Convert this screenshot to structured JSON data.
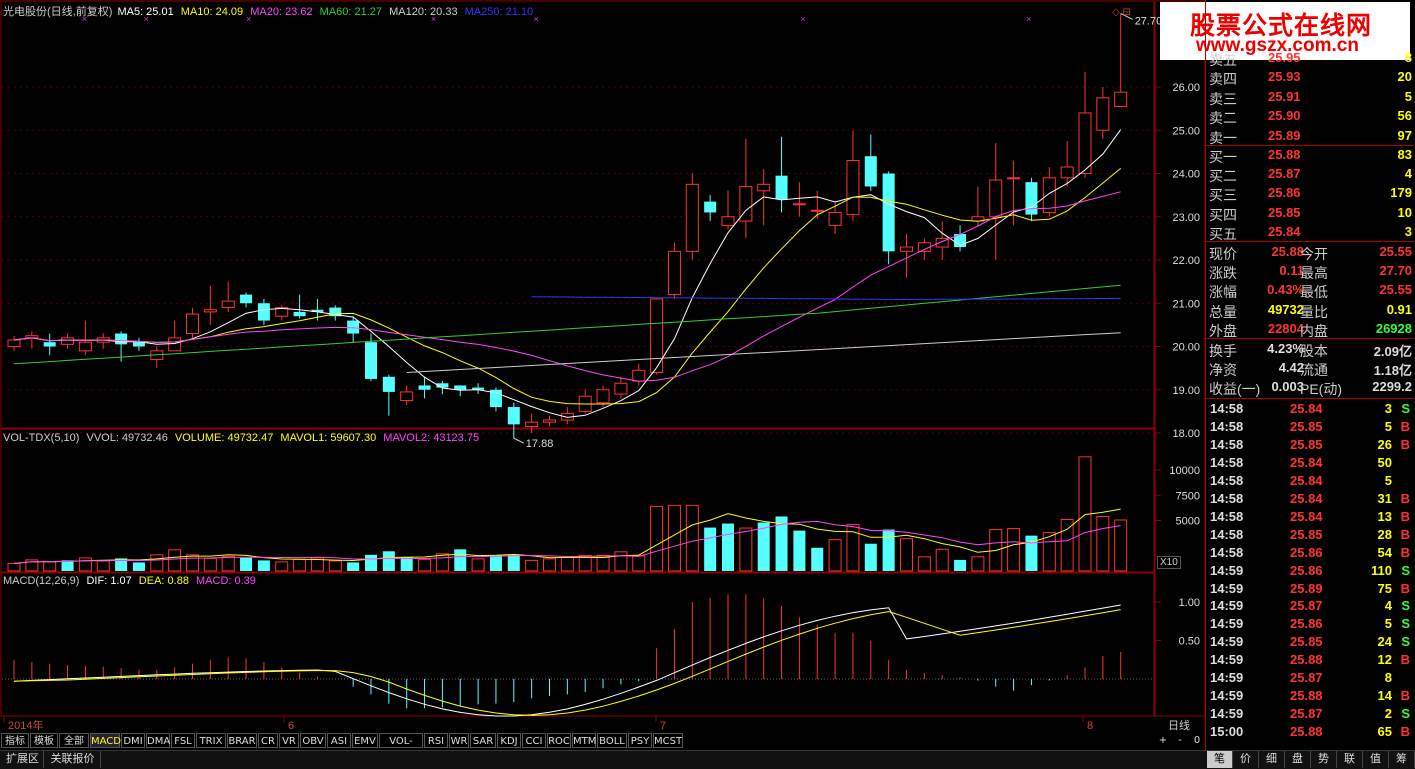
{
  "header": {
    "title": "光电股份(日线,前复权)",
    "ma5": "MA5: 25.01",
    "ma10": "MA10: 24.09",
    "ma20": "MA20: 23.62",
    "ma60": "MA60: 21.27",
    "ma120": "MA120: 20.33",
    "ma250": "MA250: 21.10"
  },
  "watermark": {
    "line1": "股票公式在线网",
    "line2": "www.gszx.com.cn"
  },
  "price_axis": [
    "26.00",
    "25.00",
    "24.00",
    "23.00",
    "22.00",
    "21.00",
    "20.00",
    "19.00",
    "18.00"
  ],
  "annotations": {
    "high": "27.70",
    "low": "17.88"
  },
  "volume": {
    "header": "VOL-TDX(5,10)",
    "vvol": "VVOL: 49732.46",
    "volume": "VOLUME: 49732.47",
    "mavol1": "MAVOL1: 59607.30",
    "mavol2": "MAVOL2: 43123.75",
    "axis": [
      "10000",
      "7500",
      "5000"
    ],
    "unit": "X10"
  },
  "macd": {
    "header": "MACD(12,26,9)",
    "dif": "DIF: 1.07",
    "dea": "DEA: 0.88",
    "macd": "MACD: 0.39",
    "axis": [
      "1.00",
      "0.50"
    ]
  },
  "date_axis": {
    "labels": [
      "2014年",
      "6",
      "7",
      "8"
    ],
    "period": "日线"
  },
  "indicator_tabs": [
    "指标",
    "模板",
    "全部",
    "MACD",
    "DMI",
    "DMA",
    "FSL",
    "TRIX",
    "BRAR",
    "CR",
    "VR",
    "OBV",
    "ASI",
    "EMV",
    "VOL-TDX",
    "RSI",
    "WR",
    "SAR",
    "KDJ",
    "CCI",
    "ROC",
    "MTM",
    "BOLL",
    "PSY",
    "MCST"
  ],
  "zoom_buttons": [
    "+",
    "-",
    "0"
  ],
  "bottom_tabs": [
    "扩展区",
    "关联报价"
  ],
  "panel_nav": [
    "笔",
    "价",
    "细",
    "盘",
    "势",
    "联",
    "值",
    "筹"
  ],
  "order_book": {
    "asks": [
      {
        "label": "卖五",
        "price": "25.95",
        "vol": "8"
      },
      {
        "label": "卖四",
        "price": "25.93",
        "vol": "20"
      },
      {
        "label": "卖三",
        "price": "25.91",
        "vol": "5"
      },
      {
        "label": "卖二",
        "price": "25.90",
        "vol": "56"
      },
      {
        "label": "卖一",
        "price": "25.89",
        "vol": "97"
      }
    ],
    "bids": [
      {
        "label": "买一",
        "price": "25.88",
        "vol": "83"
      },
      {
        "label": "买二",
        "price": "25.87",
        "vol": "4"
      },
      {
        "label": "买三",
        "price": "25.86",
        "vol": "179"
      },
      {
        "label": "买四",
        "price": "25.85",
        "vol": "10"
      },
      {
        "label": "买五",
        "price": "25.84",
        "vol": "3"
      }
    ]
  },
  "stats": [
    {
      "l1": "现价",
      "v1": "25.88",
      "l2": "今开",
      "v2": "25.55",
      "c1": "#ff3333",
      "c2": "#ff3333"
    },
    {
      "l1": "涨跌",
      "v1": "0.11",
      "l2": "最高",
      "v2": "27.70",
      "c1": "#ff3333",
      "c2": "#ff3333"
    },
    {
      "l1": "涨幅",
      "v1": "0.43%",
      "l2": "最低",
      "v2": "25.55",
      "c1": "#ff3333",
      "c2": "#ff3333"
    },
    {
      "l1": "总量",
      "v1": "49732",
      "l2": "量比",
      "v2": "0.91",
      "c1": "#ffff00",
      "c2": "#ffff00"
    },
    {
      "l1": "外盘",
      "v1": "22804",
      "l2": "内盘",
      "v2": "26928",
      "c1": "#ff3333",
      "c2": "#33ff33"
    }
  ],
  "stats2": [
    {
      "l1": "换手",
      "v1": "4.23%",
      "l2": "股本",
      "v2": "2.09亿"
    },
    {
      "l1": "净资",
      "v1": "4.42",
      "l2": "流通",
      "v2": "1.18亿"
    },
    {
      "l1": "收益(一)",
      "v1": "0.003",
      "l2": "PE(动)",
      "v2": "2299.2"
    }
  ],
  "ticks": [
    {
      "t": "14:58",
      "p": "25.84",
      "q": "3",
      "s": "S"
    },
    {
      "t": "14:58",
      "p": "25.85",
      "q": "5",
      "s": "B"
    },
    {
      "t": "14:58",
      "p": "25.85",
      "q": "26",
      "s": "B"
    },
    {
      "t": "14:58",
      "p": "25.84",
      "q": "50",
      "s": ""
    },
    {
      "t": "14:58",
      "p": "25.84",
      "q": "5",
      "s": ""
    },
    {
      "t": "14:58",
      "p": "25.84",
      "q": "31",
      "s": "B"
    },
    {
      "t": "14:58",
      "p": "25.84",
      "q": "13",
      "s": "B"
    },
    {
      "t": "14:58",
      "p": "25.85",
      "q": "28",
      "s": "B"
    },
    {
      "t": "14:58",
      "p": "25.86",
      "q": "54",
      "s": "B"
    },
    {
      "t": "14:59",
      "p": "25.86",
      "q": "110",
      "s": "S"
    },
    {
      "t": "14:59",
      "p": "25.89",
      "q": "75",
      "s": "B"
    },
    {
      "t": "14:59",
      "p": "25.87",
      "q": "4",
      "s": "S"
    },
    {
      "t": "14:59",
      "p": "25.86",
      "q": "5",
      "s": "S"
    },
    {
      "t": "14:59",
      "p": "25.85",
      "q": "24",
      "s": "S"
    },
    {
      "t": "14:59",
      "p": "25.88",
      "q": "12",
      "s": "B"
    },
    {
      "t": "14:59",
      "p": "25.87",
      "q": "8",
      "s": ""
    },
    {
      "t": "14:59",
      "p": "25.88",
      "q": "14",
      "s": "B"
    },
    {
      "t": "14:59",
      "p": "25.87",
      "q": "2",
      "s": "S"
    },
    {
      "t": "15:00",
      "p": "25.88",
      "q": "65",
      "s": "B"
    }
  ],
  "candles": [
    [
      20.0,
      20.15,
      20.25,
      19.9
    ],
    [
      20.2,
      20.25,
      20.35,
      19.95
    ],
    [
      20.1,
      20.0,
      20.3,
      19.8
    ],
    [
      20.05,
      20.2,
      20.3,
      19.95
    ],
    [
      19.9,
      20.1,
      20.6,
      19.8
    ],
    [
      20.1,
      20.2,
      20.3,
      19.95
    ],
    [
      20.3,
      20.05,
      20.35,
      19.65
    ],
    [
      20.1,
      20.0,
      20.2,
      19.9
    ],
    [
      19.7,
      19.9,
      20.0,
      19.5
    ],
    [
      19.9,
      20.2,
      20.6,
      19.9
    ],
    [
      20.3,
      20.75,
      20.9,
      20.2
    ],
    [
      20.8,
      20.85,
      21.4,
      20.5
    ],
    [
      20.9,
      21.05,
      21.5,
      20.8
    ],
    [
      21.2,
      21.0,
      21.25,
      20.9
    ],
    [
      21.0,
      20.6,
      21.1,
      20.5
    ],
    [
      20.7,
      20.9,
      20.95,
      20.6
    ],
    [
      20.8,
      20.7,
      21.2,
      20.65
    ],
    [
      20.85,
      20.8,
      21.1,
      20.6
    ],
    [
      20.9,
      20.7,
      20.95,
      20.6
    ],
    [
      20.6,
      20.3,
      20.7,
      20.1
    ],
    [
      20.1,
      19.25,
      20.3,
      19.2
    ],
    [
      19.3,
      18.95,
      19.35,
      18.4
    ],
    [
      18.75,
      18.95,
      19.1,
      18.65
    ],
    [
      19.1,
      19.0,
      19.3,
      18.8
    ],
    [
      19.15,
      19.05,
      19.2,
      18.9
    ],
    [
      19.1,
      19.0,
      19.1,
      18.85
    ],
    [
      19.05,
      19.0,
      19.15,
      18.9
    ],
    [
      19.0,
      18.6,
      19.05,
      18.5
    ],
    [
      18.6,
      18.2,
      18.7,
      17.88
    ],
    [
      18.15,
      18.25,
      18.45,
      18.0
    ],
    [
      18.25,
      18.3,
      18.4,
      18.15
    ],
    [
      18.3,
      18.45,
      18.6,
      18.2
    ],
    [
      18.5,
      18.85,
      19.0,
      18.45
    ],
    [
      18.7,
      19.0,
      19.1,
      18.6
    ],
    [
      18.9,
      19.15,
      19.3,
      18.8
    ],
    [
      19.2,
      19.45,
      19.6,
      19.1
    ],
    [
      19.4,
      21.1,
      21.1,
      19.35
    ],
    [
      21.2,
      22.2,
      22.4,
      21.1
    ],
    [
      22.2,
      23.75,
      24.0,
      22.0
    ],
    [
      23.35,
      23.1,
      23.5,
      22.9
    ],
    [
      22.8,
      23.0,
      23.6,
      22.7
    ],
    [
      22.9,
      23.7,
      24.8,
      22.5
    ],
    [
      23.6,
      23.75,
      24.1,
      22.8
    ],
    [
      23.95,
      23.4,
      24.85,
      23.1
    ],
    [
      23.3,
      23.3,
      23.8,
      23.0
    ],
    [
      23.15,
      23.15,
      23.6,
      22.95
    ],
    [
      22.8,
      23.1,
      23.35,
      22.6
    ],
    [
      23.05,
      24.3,
      25.0,
      22.9
    ],
    [
      24.4,
      23.7,
      24.9,
      23.6
    ],
    [
      24.0,
      22.2,
      24.05,
      21.9
    ],
    [
      22.2,
      22.3,
      22.6,
      21.6
    ],
    [
      22.2,
      22.4,
      22.5,
      22.0
    ],
    [
      22.3,
      22.5,
      22.9,
      22.0
    ],
    [
      22.6,
      22.3,
      22.8,
      22.2
    ],
    [
      22.9,
      23.0,
      23.7,
      22.8
    ],
    [
      23.0,
      23.85,
      24.7,
      22.0
    ],
    [
      23.9,
      23.9,
      24.3,
      22.8
    ],
    [
      23.8,
      23.05,
      23.9,
      22.9
    ],
    [
      23.1,
      23.9,
      24.15,
      23.0
    ],
    [
      23.9,
      24.15,
      24.75,
      23.7
    ],
    [
      24.0,
      25.4,
      26.35,
      23.9
    ],
    [
      25.0,
      25.75,
      26.0,
      24.8
    ],
    [
      25.55,
      25.88,
      27.7,
      25.55
    ]
  ],
  "vol_bars": [
    [
      750,
      "up"
    ],
    [
      1100,
      "up"
    ],
    [
      900,
      "up"
    ],
    [
      1050,
      "down"
    ],
    [
      1300,
      "up"
    ],
    [
      1000,
      "up"
    ],
    [
      1250,
      "down"
    ],
    [
      850,
      "down"
    ],
    [
      1600,
      "up"
    ],
    [
      2100,
      "up"
    ],
    [
      1600,
      "up"
    ],
    [
      1250,
      "up"
    ],
    [
      1450,
      "up"
    ],
    [
      1300,
      "down"
    ],
    [
      1050,
      "down"
    ],
    [
      900,
      "up"
    ],
    [
      1150,
      "up"
    ],
    [
      1300,
      "up"
    ],
    [
      1000,
      "up"
    ],
    [
      850,
      "down"
    ],
    [
      1600,
      "down"
    ],
    [
      1950,
      "down"
    ],
    [
      1400,
      "down"
    ],
    [
      1150,
      "up"
    ],
    [
      1700,
      "up"
    ],
    [
      2150,
      "down"
    ],
    [
      1200,
      "up"
    ],
    [
      1550,
      "down"
    ],
    [
      1600,
      "down"
    ],
    [
      1050,
      "up"
    ],
    [
      1200,
      "up"
    ],
    [
      1350,
      "up"
    ],
    [
      1550,
      "up"
    ],
    [
      1550,
      "up"
    ],
    [
      1900,
      "up"
    ],
    [
      1500,
      "up"
    ],
    [
      6400,
      "up"
    ],
    [
      6500,
      "up"
    ],
    [
      6500,
      "up"
    ],
    [
      4300,
      "down"
    ],
    [
      4700,
      "down"
    ],
    [
      4250,
      "up"
    ],
    [
      4800,
      "down"
    ],
    [
      5400,
      "down"
    ],
    [
      4000,
      "down"
    ],
    [
      2300,
      "down"
    ],
    [
      3100,
      "up"
    ],
    [
      4600,
      "up"
    ],
    [
      2700,
      "down"
    ],
    [
      4100,
      "down"
    ],
    [
      3200,
      "up"
    ],
    [
      1400,
      "up"
    ],
    [
      2150,
      "up"
    ],
    [
      1100,
      "down"
    ],
    [
      1400,
      "up"
    ],
    [
      4100,
      "up"
    ],
    [
      4200,
      "up"
    ],
    [
      3500,
      "down"
    ],
    [
      3800,
      "up"
    ],
    [
      5100,
      "up"
    ],
    [
      11300,
      "up"
    ],
    [
      5400,
      "up"
    ],
    [
      5050,
      "up"
    ]
  ],
  "macd_hist": [
    0.25,
    0.22,
    0.2,
    0.18,
    0.17,
    0.16,
    0.14,
    0.12,
    0.12,
    0.15,
    0.2,
    0.25,
    0.28,
    0.27,
    0.22,
    0.15,
    0.08,
    0.03,
    0.0,
    -0.1,
    -0.2,
    -0.32,
    -0.38,
    -0.38,
    -0.37,
    -0.35,
    -0.33,
    -0.32,
    -0.3,
    -0.25,
    -0.22,
    -0.2,
    -0.17,
    -0.12,
    -0.07,
    -0.03,
    0.4,
    0.65,
    1.0,
    1.05,
    1.1,
    1.1,
    1.05,
    0.95,
    0.8,
    0.7,
    0.6,
    0.6,
    0.5,
    0.25,
    0.12,
    0.08,
    0.05,
    0.02,
    -0.02,
    -0.1,
    -0.15,
    -0.08,
    -0.02,
    0.05,
    0.15,
    0.3,
    0.35
  ],
  "colors": {
    "up": "#ff3232",
    "down": "#54ffff",
    "ma5": "#ffffff",
    "ma10": "#ffff00",
    "ma20": "#ff44ff",
    "ma60": "#33cc33",
    "ma120": "#cccccc",
    "ma250": "#3333ff",
    "grid": "#8b0000"
  }
}
